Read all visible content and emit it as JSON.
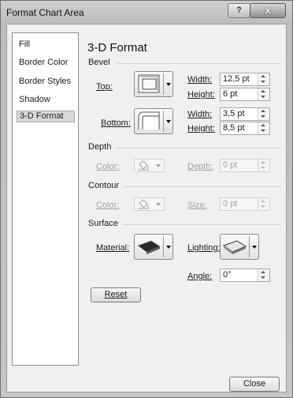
{
  "window": {
    "title": "Format Chart Area",
    "help_label": "?",
    "close_glyph": "x"
  },
  "sidebar": {
    "items": [
      {
        "label": "Fill"
      },
      {
        "label": "Border Color"
      },
      {
        "label": "Border Styles"
      },
      {
        "label": "Shadow"
      },
      {
        "label": "3-D Format",
        "selected": true
      }
    ]
  },
  "panel": {
    "title": "3-D Format",
    "bevel": {
      "group_label": "Bevel",
      "top_label": "Top:",
      "bottom_label": "Bottom:",
      "top_width_label": "Width:",
      "top_width_value": "12,5 pt",
      "top_height_label": "Height:",
      "top_height_value": "6 pt",
      "bottom_width_label": "Width:",
      "bottom_width_value": "3,5 pt",
      "bottom_height_label": "Height:",
      "bottom_height_value": "8,5 pt"
    },
    "depth": {
      "group_label": "Depth",
      "color_label": "Color:",
      "depth_label": "Depth:",
      "depth_value": "0 pt"
    },
    "contour": {
      "group_label": "Contour",
      "color_label": "Color:",
      "size_label": "Size:",
      "size_value": "0 pt"
    },
    "surface": {
      "group_label": "Surface",
      "material_label": "Material:",
      "lighting_label": "Lighting:",
      "angle_label": "Angle:",
      "angle_value": "0°"
    },
    "reset_label": "Reset"
  },
  "footer": {
    "close_label": "Close"
  },
  "icons": {
    "help": "help-icon",
    "close": "close-icon",
    "dropdown": "chevron-down-icon",
    "paint_bucket": "paint-bucket-icon",
    "spin_up": "spin-up-icon",
    "spin_down": "spin-down-icon"
  }
}
